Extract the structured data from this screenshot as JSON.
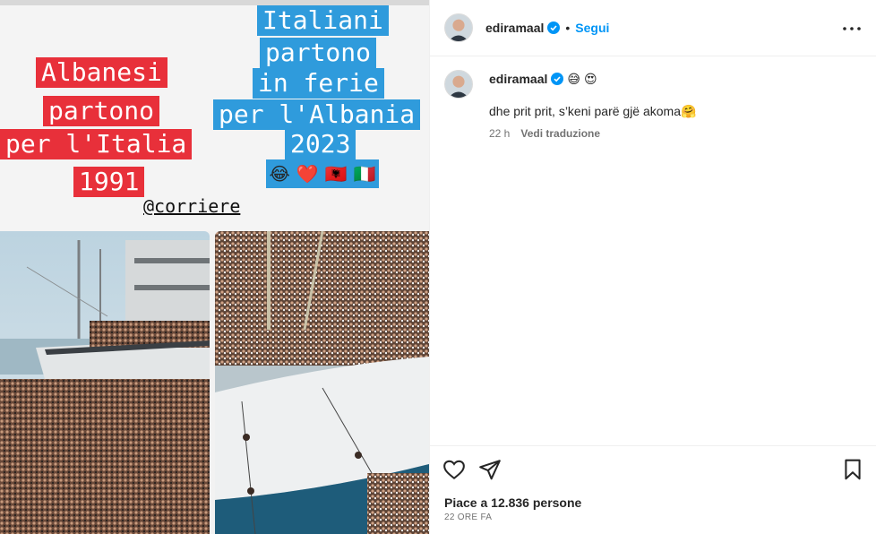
{
  "post_image": {
    "left_caption": [
      "Albanesi",
      "partono",
      "per l'Italia",
      "1991"
    ],
    "right_caption": [
      "Italiani",
      "partono",
      "in ferie",
      "per l'Albania",
      "2023"
    ],
    "emoji_strip": [
      "😂",
      "❤️",
      "🇦🇱",
      "🇮🇹"
    ],
    "handle": "@corriere"
  },
  "header": {
    "username": "ediramaal",
    "separator": "•",
    "follow_label": "Segui"
  },
  "comment": {
    "username": "ediramaal",
    "emojis": [
      "😅",
      "😍"
    ],
    "text": "dhe prit prit, s’keni parë gjë akoma🤗",
    "age": "22 h",
    "translate_label": "Vedi traduzione"
  },
  "footer": {
    "likes_text": "Piace a 12.836 persone",
    "posted_ago": "22 ORE FA"
  },
  "colors": {
    "accent": "#0095f6",
    "verified": "#0095f6",
    "red_caption": "#e8303a",
    "blue_caption": "#2f9bdc"
  },
  "icons": [
    "verified-icon",
    "more-options-icon",
    "heart-icon",
    "share-icon",
    "bookmark-icon"
  ]
}
